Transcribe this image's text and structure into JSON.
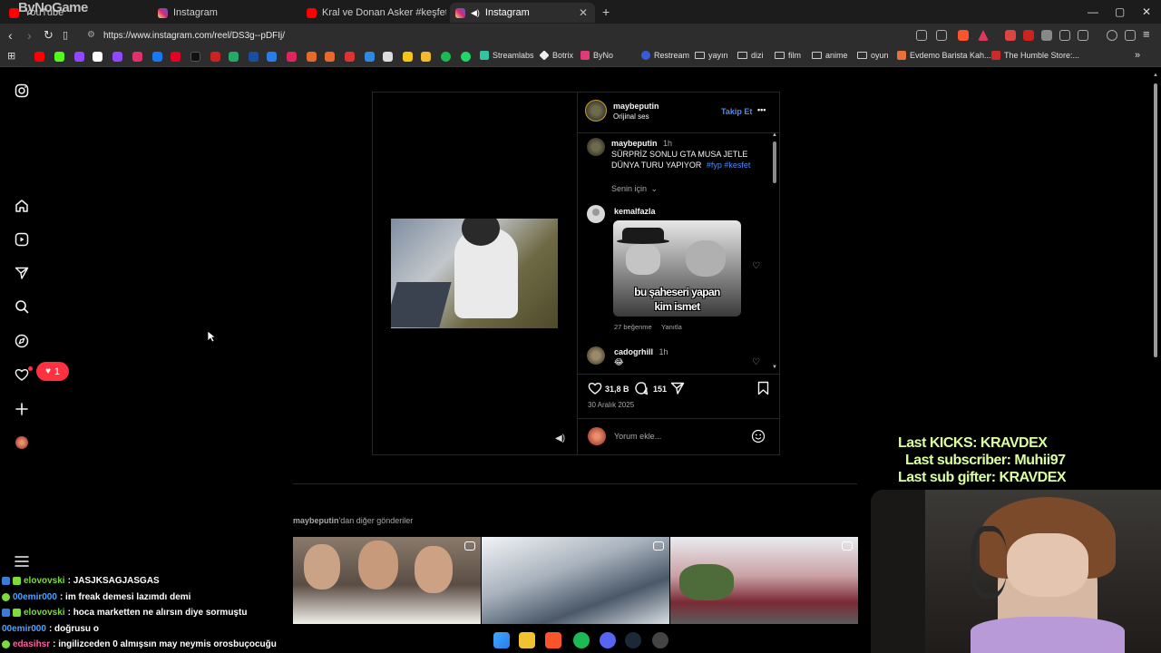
{
  "browser": {
    "tabs": [
      {
        "label": "YouTube",
        "color": "#ff0000"
      },
      {
        "label": "Instagram",
        "color": "#e1306c"
      },
      {
        "label": "Kral ve Donan Asker #keşfet #history",
        "color": "#ff0000"
      },
      {
        "label": "Instagram",
        "color": "#e1306c",
        "active": true
      }
    ],
    "url": "https://www.instagram.com/reel/DS3g--pDFIj/",
    "new_tab": "+",
    "bookmarks": [
      "Streamlabs",
      "Botrix",
      "ByNo",
      "Restream",
      "yayın",
      "dizi",
      "film",
      "anime",
      "oyun",
      "Evdemo Barista Kah...",
      "The Humble Store:..."
    ]
  },
  "stream_logo": "ByNoGame",
  "instagram": {
    "notification_count": "1",
    "post": {
      "username": "maybeputin",
      "audio": "Orijinal ses",
      "follow_label": "Takip Et",
      "more_label": "•••",
      "caption_user": "maybeputin",
      "caption_time": "1h",
      "caption_line1": "SÜRPRİZ SONLU GTA MUSA JETLE",
      "caption_line2": "DÜNYA TURU YAPIYOR",
      "caption_tags": "#fyp #kesfet",
      "for_you": "Senin için",
      "comments": [
        {
          "user": "kemalfazla",
          "meme_text_1": "bu şaheseri yapan",
          "meme_text_2": "kim ismet",
          "likes": "27 beğenme",
          "reply": "Yanıtla"
        },
        {
          "user": "cadogrhill",
          "time": "1h",
          "text": "😂"
        }
      ],
      "like_count": "31,8 B",
      "comment_count": "151",
      "date": "30 Aralık 2025",
      "comment_placeholder": "Yorum ekle..."
    },
    "more_posts_user": "maybeputin",
    "more_posts_suffix": "'dan diğer gönderiler"
  },
  "overlay": {
    "last_kicks": "Last KICKS: KRAVDEX",
    "last_sub": "Last subscriber: Muhii97",
    "last_gifter": "Last sub gifter: KRAVDEX"
  },
  "chat": [
    {
      "user": "elovovski",
      "text": ": JASJKSAGJASGAS",
      "color": "#7cdc3a"
    },
    {
      "user": "00emir000",
      "text": ": im freak demesi lazımdı demi",
      "color": "#4aa3ff"
    },
    {
      "user": "elovovski",
      "text": ": hoca marketten ne alırsın diye sormuştu",
      "color": "#7cdc3a"
    },
    {
      "user": "00emir000",
      "text": ": doğrusu o",
      "color": "#4aa3ff"
    },
    {
      "user": "edasihsr",
      "text": ": ingilizceden 0 almışsın may neymis orosbuçocuğu",
      "color": "#ff5fa2"
    }
  ]
}
